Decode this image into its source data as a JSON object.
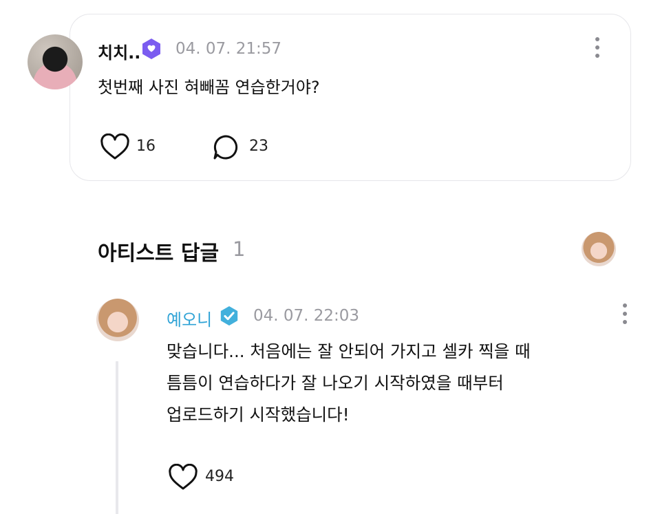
{
  "comment": {
    "author": "치치..",
    "timestamp": "04. 07. 21:57",
    "text": "첫번째 사진 혀빼꼼 연습한거야?",
    "likes": "16",
    "replies": "23"
  },
  "artist_section": {
    "title": "아티스트 답글",
    "count": "1"
  },
  "reply": {
    "author": "예오니",
    "timestamp": "04. 07. 22:03",
    "lines": [
      "맞습니다... 처음에는 잘 안되어 가지고 셀카 찍을 때",
      "틈틈이 연습하다가 잘 나오기 시작하였을 때부터",
      "업로드하기 시작했습니다!"
    ],
    "likes": "494"
  },
  "colors": {
    "artist_name": "#2fa3d6",
    "badge_purple": "#7b5cf0",
    "badge_blue": "#42b0dc",
    "muted": "#9a9aa0"
  }
}
